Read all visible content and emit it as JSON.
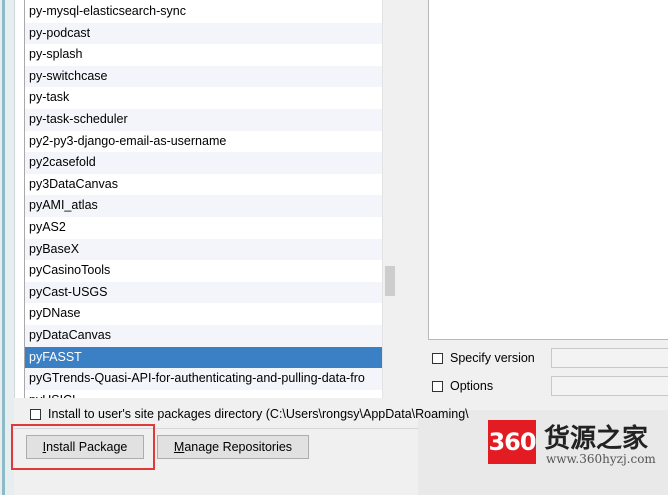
{
  "packages": [
    "py-mysql-elasticsearch-sync",
    "py-podcast",
    "py-splash",
    "py-switchcase",
    "py-task",
    "py-task-scheduler",
    "py2-py3-django-email-as-username",
    "py2casefold",
    "py3DataCanvas",
    "pyAMI_atlas",
    "pyAS2",
    "pyBaseX",
    "pyCasinoTools",
    "pyCast-USGS",
    "pyDNase",
    "pyDataCanvas",
    "pyFASST",
    "pyGTrends-Quasi-API-for-authenticating-and-pulling-data-fro",
    "pyHSICL"
  ],
  "selected_package": "pyFASST",
  "options": {
    "specify_version_label": "Specify version",
    "options_label": "Options"
  },
  "site_packages_label": "Install to user's site packages directory (C:\\Users\\rongsy\\AppData\\Roaming\\",
  "buttons": {
    "install_first": "I",
    "install_rest": "nstall Package",
    "manage_first": "M",
    "manage_rest": "anage Repositories"
  },
  "watermark": {
    "badge": "360",
    "title": "货源之家",
    "url": "www.360hyzj.com"
  },
  "colors": {
    "selection": "#3b7fc4",
    "highlight": "#e0393a",
    "watermark_red": "#e31c23"
  }
}
